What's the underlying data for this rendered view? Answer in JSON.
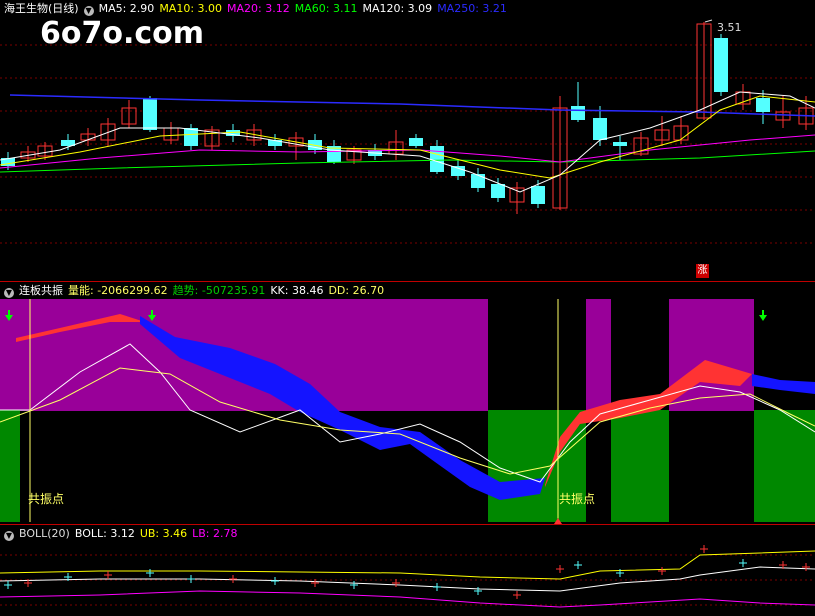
{
  "panel1": {
    "title": "海王生物(日线)",
    "indicators": [
      {
        "label": "MA5: 2.90",
        "color": "#ffffff"
      },
      {
        "label": "MA10: 3.00",
        "color": "#ffff00"
      },
      {
        "label": "MA20: 3.12",
        "color": "#ff00ff"
      },
      {
        "label": "MA60: 3.11",
        "color": "#00ff00"
      },
      {
        "label": "MA120: 3.09",
        "color": "#ffffff"
      },
      {
        "label": "MA250: 3.21",
        "color": "#2b2bff"
      }
    ],
    "watermark": "6o7o.com",
    "high_label": "3.51",
    "marker": "涨"
  },
  "panel2": {
    "title": "连板共振",
    "indicators": [
      {
        "label": "量能: -2066299.62",
        "color": "#ffff66"
      },
      {
        "label": "趋势: -507235.91",
        "color": "#00cc00"
      },
      {
        "label": "KK: 38.46",
        "color": "#ffffff"
      },
      {
        "label": "DD: 26.70",
        "color": "#ffff66"
      }
    ],
    "resonance_label_1": "共振点",
    "resonance_label_2": "共振点"
  },
  "panel3": {
    "title": "BOLL(20)",
    "indicators": [
      {
        "label": "BOLL: 3.12",
        "color": "#ffffff"
      },
      {
        "label": "UB: 3.46",
        "color": "#ffff00"
      },
      {
        "label": "LB: 2.78",
        "color": "#ff00ff"
      }
    ]
  },
  "colors": {
    "up": "#ff3333",
    "down": "#54ffff",
    "purple_zone": "#990099",
    "green_zone": "#008800",
    "red_band": "#ff3333",
    "blue_band": "#1414ff"
  }
}
